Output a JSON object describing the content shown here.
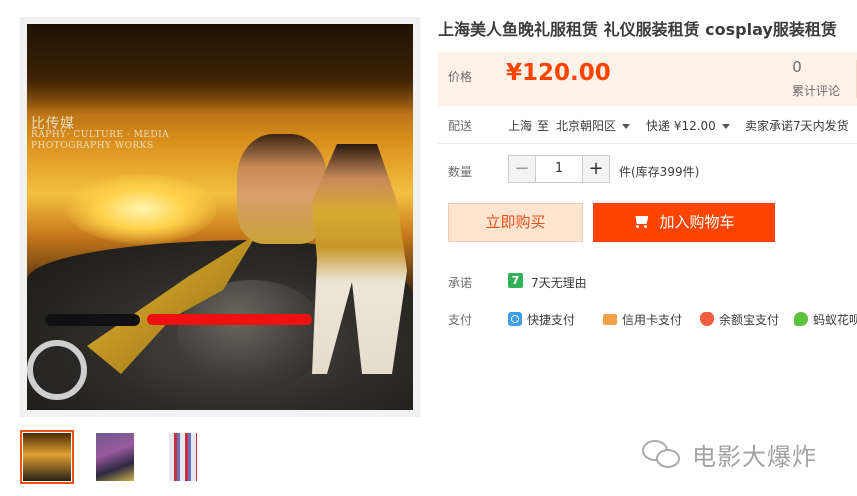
{
  "product": {
    "title": "上海美人鱼晚礼服租赁 礼仪服装租赁 cosplay服装租赁"
  },
  "gallery": {
    "photo_text_line1": "比传媒",
    "photo_text_line2": "RAPHY· CULTURE · MEDIA",
    "photo_text_line3": "PHOTOGRAPHY WORKS",
    "thumbnails": [
      "thumb-1",
      "thumb-2",
      "thumb-3"
    ],
    "active_thumbnail": 0
  },
  "price": {
    "label": "价格",
    "value": "¥120.00",
    "review_count": "0",
    "review_label": "累计评论"
  },
  "shipping": {
    "label": "配送",
    "from": "上海",
    "to_word": "至",
    "region": "北京朝阳区",
    "express": "快递 ¥12.00",
    "promise": "卖家承诺7天内发货"
  },
  "quantity": {
    "label": "数量",
    "minus": "−",
    "value": "1",
    "plus": "+",
    "unit_stock": "件(库存399件)"
  },
  "actions": {
    "buy_now": "立即购买",
    "add_to_cart": "加入购物车"
  },
  "promise": {
    "label": "承诺",
    "icon_text": "7",
    "text": "7天无理由"
  },
  "payment": {
    "label": "支付",
    "methods": [
      "快捷支付",
      "信用卡支付",
      "余额宝支付",
      "蚂蚁花呗"
    ]
  },
  "watermark": {
    "text": "电影大爆炸"
  },
  "colors": {
    "accent": "#ff4400",
    "price": "#ff4400",
    "price_bg": "#fff2e8",
    "buy_now_bg": "#ffe4d0",
    "promise_green": "#33b05a"
  }
}
